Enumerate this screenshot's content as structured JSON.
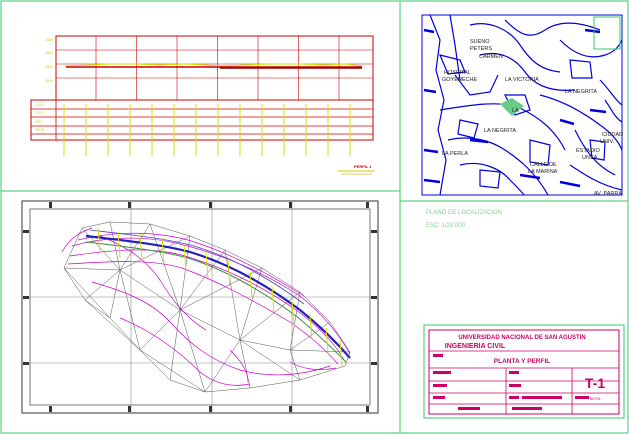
{
  "sheet": {
    "profile": {
      "label": "PERFIL 1",
      "elevation_ticks": [
        "2580",
        "2560",
        "2540",
        "2520"
      ],
      "table_rows": [
        "COTA",
        "COTA",
        "DIST.",
        "PROG."
      ]
    },
    "location_map": {
      "streets": [
        {
          "label": "SUENO",
          "id": "suenos"
        },
        {
          "label": "PETERS",
          "id": "peters"
        },
        {
          "label": "CARMEN",
          "id": "carmen"
        },
        {
          "label": "HOSPITAL",
          "id": "hospital"
        },
        {
          "label": "GOYENECHE",
          "id": "goyeneche"
        },
        {
          "label": "LA VICTORIA",
          "id": "victoria"
        },
        {
          "label": "LA NEGRITA",
          "id": "negrita"
        },
        {
          "label": "LA",
          "id": "la"
        },
        {
          "label": "LA NEGRITA",
          "id": "negrita2"
        },
        {
          "label": "LA PERLA",
          "id": "perla"
        },
        {
          "label": "CALLE DE",
          "id": "calle"
        },
        {
          "label": "LA MARINA",
          "id": "marina"
        },
        {
          "label": "ESTADIO",
          "id": "estadio"
        },
        {
          "label": "UNSA",
          "id": "unsa"
        },
        {
          "label": "CIUDAD",
          "id": "ciudad"
        },
        {
          "label": "UNIV.",
          "id": "univ"
        },
        {
          "label": "AV. PARRA",
          "id": "parra"
        }
      ]
    },
    "location_caption": {
      "title": "PLANO DE LOCALIZACION",
      "scale": "ESC: 1/20 000"
    },
    "title_block": {
      "university": "UNIVERSIDAD NACIONAL DE SAN AGUSTIN",
      "faculty": "INGENIERIA CIVIL",
      "drawing_title": "PLANTA Y PERFIL",
      "sheet_number": "T-1",
      "note": "NOTA"
    }
  },
  "colors": {
    "background": "#ffffff",
    "sheet_border": "#33cc66",
    "profile_grid": "#cc0000",
    "profile_line": "#dddd00",
    "terrain_tin": "#555555",
    "contours": "#cc00cc",
    "alignment": "#2222bb",
    "ticks": "#dddd00",
    "map_streets": "#0000dd",
    "title_block": "#cc0066"
  }
}
